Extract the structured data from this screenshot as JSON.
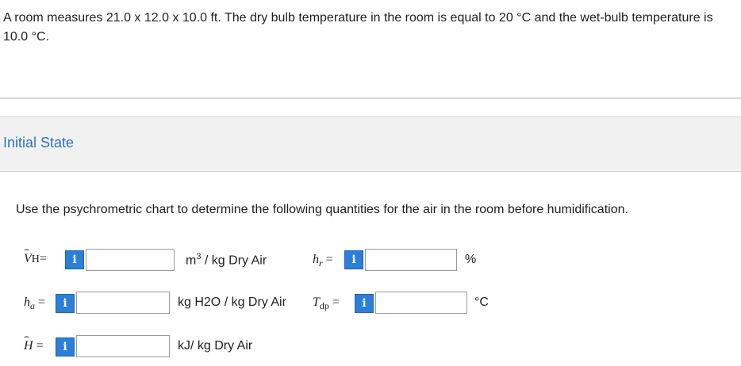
{
  "problem": {
    "text": "A room measures 21.0 x 12.0 x 10.0 ft. The dry bulb temperature in the room is equal to 20 °C and the wet-bulb temperature is 10.0 °C."
  },
  "section": {
    "title": "Initial State"
  },
  "instruction": "Use the psychrometric chart to determine the following quantities for the air in the room before humidification.",
  "info_glyph": "i",
  "fields": {
    "vh": {
      "unit_prefix": "m",
      "unit_exp": "3",
      "unit_suffix": "/ kg Dry Air",
      "value": ""
    },
    "hr": {
      "unit": "%",
      "value": ""
    },
    "ha": {
      "unit": "kg H2O / kg Dry Air",
      "value": ""
    },
    "tdp": {
      "unit": "°C",
      "value": ""
    },
    "h": {
      "unit": "kJ/ kg Dry Air",
      "value": ""
    }
  }
}
